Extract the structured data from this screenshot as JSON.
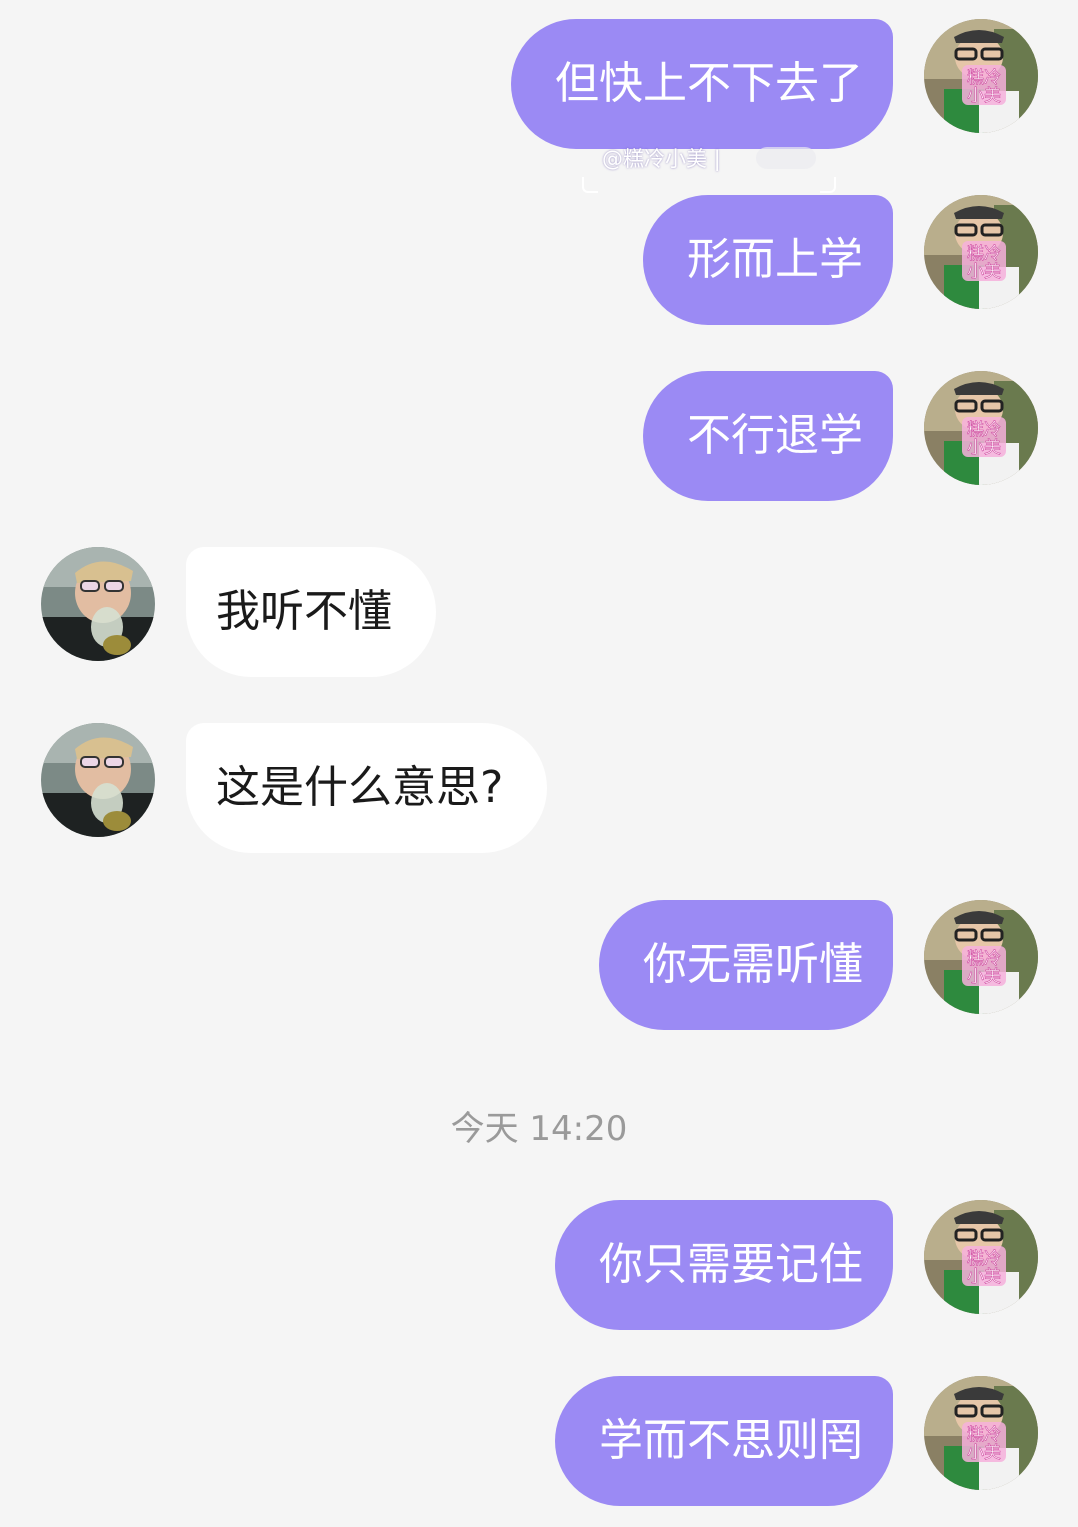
{
  "chat": {
    "messages": [
      {
        "side": "me",
        "text": "但快上不下去了"
      },
      {
        "side": "me",
        "text": "形而上学"
      },
      {
        "side": "me",
        "text": "不行退学"
      },
      {
        "side": "them",
        "text": "我听不懂"
      },
      {
        "side": "them",
        "text": "这是什么意思?"
      },
      {
        "side": "me",
        "text": "你无需听懂"
      },
      {
        "side": "me",
        "text": "你只需要记住"
      },
      {
        "side": "me",
        "text": "学而不思则罔"
      }
    ],
    "timestamp": "今天 14:20",
    "watermark": "@糕冷小美  |",
    "avatar_badge": "糕冷小美"
  },
  "colors": {
    "background": "#f5f5f5",
    "my_bubble": "#9b8af4",
    "their_bubble": "#ffffff",
    "timestamp_text": "#9a9a9a"
  }
}
